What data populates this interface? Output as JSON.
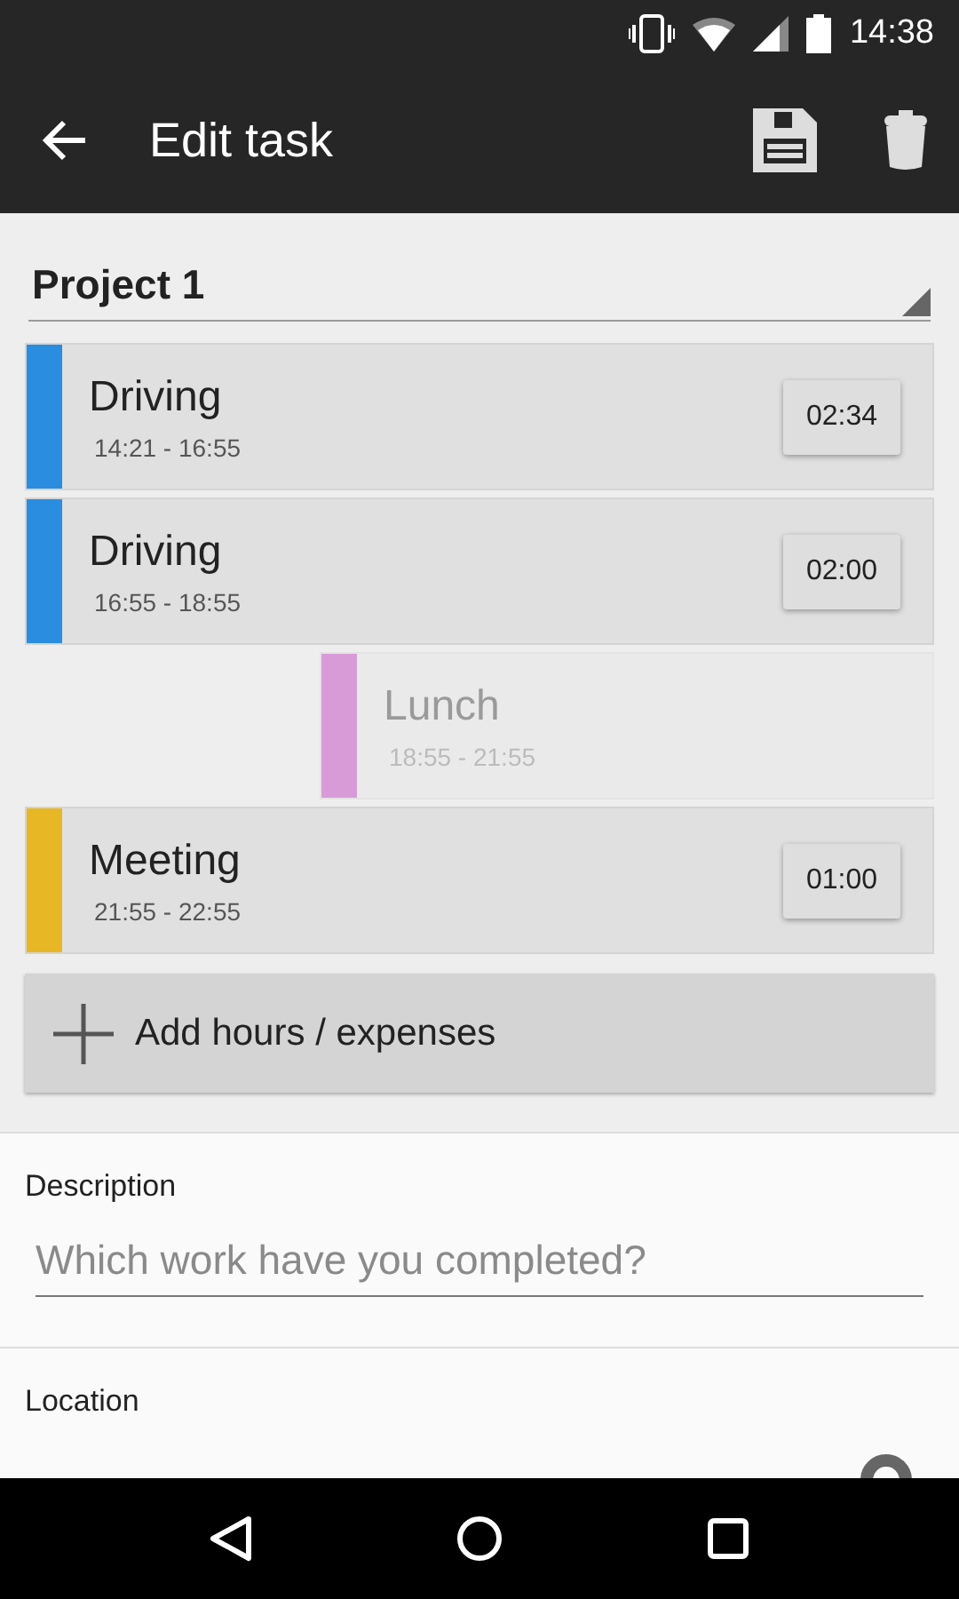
{
  "status_bar": {
    "time": "14:38"
  },
  "app_bar": {
    "title": "Edit task"
  },
  "project": {
    "value": "Project 1"
  },
  "entries": [
    {
      "kind": "work",
      "title": "Driving",
      "time": "14:21 - 16:55",
      "duration": "02:34",
      "color": "#2b8de0"
    },
    {
      "kind": "work",
      "title": "Driving",
      "time": "16:55 - 18:55",
      "duration": "02:00",
      "color": "#2b8de0"
    },
    {
      "kind": "break",
      "title": "Lunch",
      "time": "18:55 - 21:55",
      "color": "#d99bd8"
    },
    {
      "kind": "work",
      "title": "Meeting",
      "time": "21:55 - 22:55",
      "duration": "01:00",
      "color": "#e8b726"
    }
  ],
  "add_button": {
    "label": "Add hours / expenses"
  },
  "description": {
    "label": "Description",
    "placeholder": "Which work have you completed?"
  },
  "location": {
    "label": "Location"
  }
}
